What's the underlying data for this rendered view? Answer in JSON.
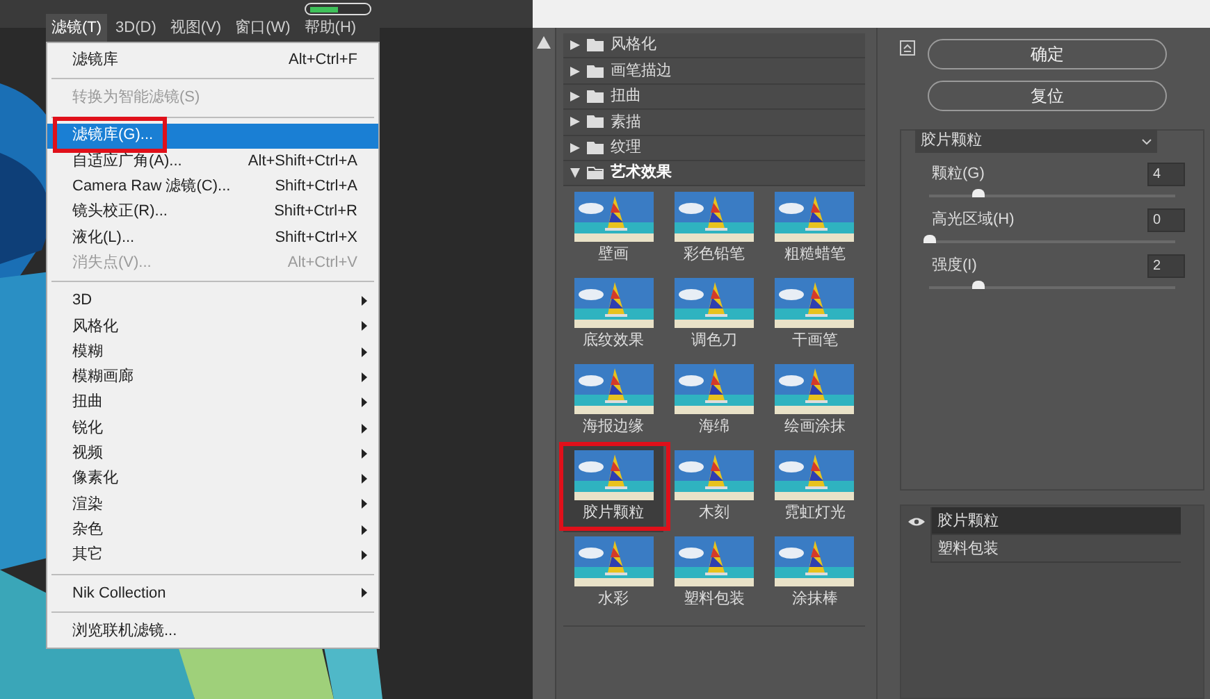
{
  "menu_bar": [
    {
      "label": "滤镜(T)",
      "selected": true
    },
    {
      "label": "3D(D)",
      "selected": false
    },
    {
      "label": "视图(V)",
      "selected": false
    },
    {
      "label": "窗口(W)",
      "selected": false
    },
    {
      "label": "帮助(H)",
      "selected": false
    }
  ],
  "filter_menu": [
    {
      "kind": "item",
      "label": "滤镜库",
      "shortcut": "Alt+Ctrl+F",
      "disabled": false,
      "selected": false,
      "annotated": false
    },
    {
      "kind": "separator"
    },
    {
      "kind": "item",
      "label": "转换为智能滤镜(S)",
      "disabled": true,
      "selected": false,
      "annotated": false
    },
    {
      "kind": "separator"
    },
    {
      "kind": "item",
      "label": "滤镜库(G)...",
      "disabled": false,
      "selected": true,
      "annotated": true
    },
    {
      "kind": "item",
      "label": "自适应广角(A)...",
      "shortcut": "Alt+Shift+Ctrl+A",
      "disabled": false,
      "selected": false,
      "annotated": false
    },
    {
      "kind": "item",
      "label": "Camera Raw 滤镜(C)...",
      "shortcut": "Shift+Ctrl+A",
      "disabled": false,
      "selected": false,
      "annotated": false
    },
    {
      "kind": "item",
      "label": "镜头校正(R)...",
      "shortcut": "Shift+Ctrl+R",
      "disabled": false,
      "selected": false,
      "annotated": false
    },
    {
      "kind": "item",
      "label": "液化(L)...",
      "shortcut": "Shift+Ctrl+X",
      "disabled": false,
      "selected": false,
      "annotated": false
    },
    {
      "kind": "item",
      "label": "消失点(V)...",
      "shortcut": "Alt+Ctrl+V",
      "disabled": true,
      "selected": false,
      "annotated": false
    },
    {
      "kind": "separator"
    },
    {
      "kind": "submenu",
      "label": "3D"
    },
    {
      "kind": "submenu",
      "label": "风格化"
    },
    {
      "kind": "submenu",
      "label": "模糊"
    },
    {
      "kind": "submenu",
      "label": "模糊画廊"
    },
    {
      "kind": "submenu",
      "label": "扭曲"
    },
    {
      "kind": "submenu",
      "label": "锐化"
    },
    {
      "kind": "submenu",
      "label": "视频"
    },
    {
      "kind": "submenu",
      "label": "像素化"
    },
    {
      "kind": "submenu",
      "label": "渲染"
    },
    {
      "kind": "submenu",
      "label": "杂色"
    },
    {
      "kind": "submenu",
      "label": "其它"
    },
    {
      "kind": "separator"
    },
    {
      "kind": "submenu",
      "label": "Nik Collection"
    },
    {
      "kind": "separator"
    },
    {
      "kind": "item",
      "label": "浏览联机滤镜...",
      "disabled": false,
      "selected": false,
      "annotated": false
    }
  ],
  "gallery": [
    {
      "label": "风格化",
      "expanded": false
    },
    {
      "label": "画笔描边",
      "expanded": false
    },
    {
      "label": "扭曲",
      "expanded": false
    },
    {
      "label": "素描",
      "expanded": false
    },
    {
      "label": "纹理",
      "expanded": false
    },
    {
      "label": "艺术效果",
      "expanded": true,
      "filters": [
        {
          "label": "壁画",
          "selected": false,
          "annotated": false
        },
        {
          "label": "彩色铅笔",
          "selected": false,
          "annotated": false
        },
        {
          "label": "粗糙蜡笔",
          "selected": false,
          "annotated": false
        },
        {
          "label": "底纹效果",
          "selected": false,
          "annotated": false
        },
        {
          "label": "调色刀",
          "selected": false,
          "annotated": false
        },
        {
          "label": "干画笔",
          "selected": false,
          "annotated": false
        },
        {
          "label": "海报边缘",
          "selected": false,
          "annotated": false
        },
        {
          "label": "海绵",
          "selected": false,
          "annotated": false
        },
        {
          "label": "绘画涂抹",
          "selected": false,
          "annotated": false
        },
        {
          "label": "胶片颗粒",
          "selected": true,
          "annotated": true
        },
        {
          "label": "木刻",
          "selected": false,
          "annotated": false
        },
        {
          "label": "霓虹灯光",
          "selected": false,
          "annotated": false
        },
        {
          "label": "水彩",
          "selected": false,
          "annotated": false
        },
        {
          "label": "塑料包装",
          "selected": false,
          "annotated": false
        },
        {
          "label": "涂抹棒",
          "selected": false,
          "annotated": false
        }
      ]
    }
  ],
  "settings": {
    "buttons": [
      "确定",
      "复位"
    ],
    "filter_select": "胶片颗粒",
    "params": [
      {
        "label": "颗粒(G)",
        "value": "4",
        "level": 0.2
      },
      {
        "label": "高光区域(H)",
        "value": "0",
        "level": 0
      },
      {
        "label": "强度(I)",
        "value": "2",
        "level": 0.2
      }
    ]
  },
  "effect_layers": [
    {
      "label": "胶片颗粒",
      "visible": true,
      "selected": true
    },
    {
      "label": "塑料包装",
      "visible": false,
      "selected": false
    }
  ]
}
